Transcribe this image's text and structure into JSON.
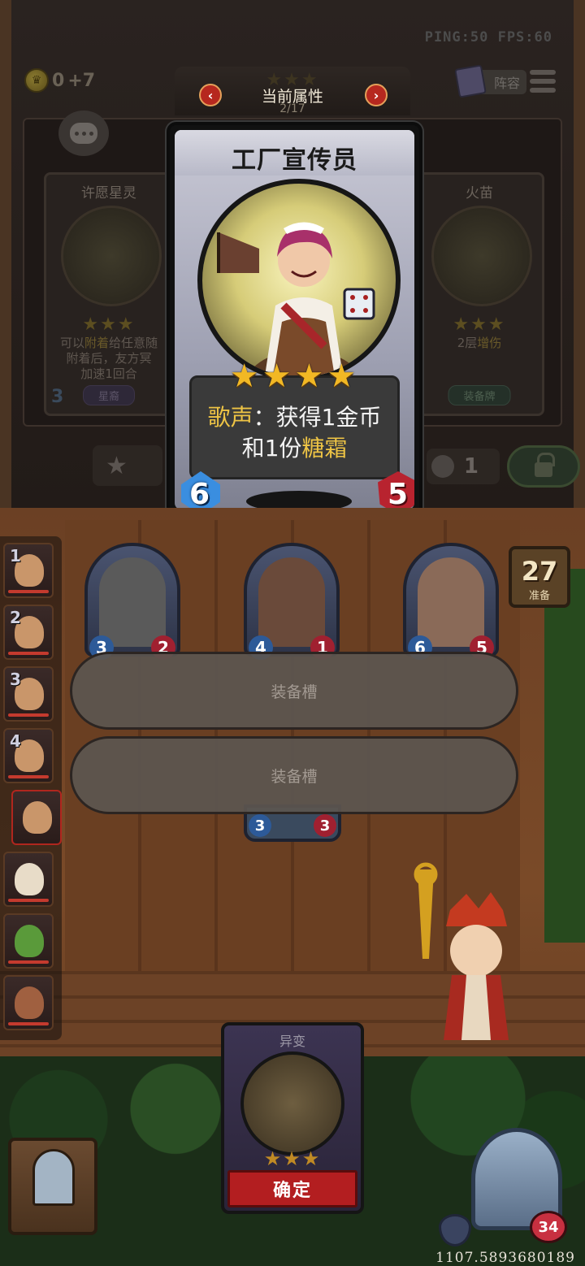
{
  "status": {
    "text": "PING:50   FPS:60"
  },
  "gold": {
    "amount": "0",
    "income": "+7"
  },
  "lineup": {
    "label": "阵容"
  },
  "attribute_panel": {
    "title": "当前属性",
    "page": "2/17",
    "prev_symbol": "‹",
    "next_symbol": "›"
  },
  "focused_card": {
    "name": "工厂宣传员",
    "stars": "★★★★",
    "star_count": 4,
    "desc_keyword": "歌声",
    "desc_sep": "：",
    "desc_line1_rest": "获得1金币",
    "desc_line2_prefix": "和1份",
    "desc_line2_keyword": "糖霜",
    "attack": "6",
    "health": "5"
  },
  "left_card": {
    "name": "许愿星灵",
    "stars": "★★★",
    "desc_prefix": "可以",
    "desc_keyword": "附着",
    "desc_rest1": "给任意随",
    "desc_line2": "附着后，友方冥",
    "desc_line3": "加速1回合",
    "cost": "3",
    "tag": "星裔"
  },
  "right_card": {
    "name": "火苗",
    "stars": "★★★",
    "desc_prefix": "2层",
    "desc_keyword": "增伤",
    "tag": "装备牌"
  },
  "right_pill": {
    "value": "1"
  },
  "roster": [
    {
      "num": "1"
    },
    {
      "num": "2"
    },
    {
      "num": "3"
    },
    {
      "num": "4"
    },
    {
      "num": ""
    },
    {
      "num": ""
    },
    {
      "num": ""
    },
    {
      "num": ""
    }
  ],
  "board": [
    {
      "atk": "3",
      "hp": "2"
    },
    {
      "atk": "4",
      "hp": "1"
    },
    {
      "atk": "6",
      "hp": "5"
    }
  ],
  "bottom_piece": {
    "atk": "3",
    "hp": "3"
  },
  "prep": {
    "count": "27",
    "label": "准备"
  },
  "equip_slots": [
    {
      "label": "装备槽"
    },
    {
      "label": "装备槽"
    }
  ],
  "mutation_card": {
    "title": "异变",
    "stars": "★★★"
  },
  "confirm": {
    "label": "确定"
  },
  "hero": {
    "hp": "34"
  },
  "session_id": "1107.5893680189",
  "colors": {
    "accent_gold": "#eec445",
    "confirm_red": "#b31e20",
    "star_gold": "#f2b824"
  },
  "icons": [
    "coin-icon",
    "book-icon",
    "menu-icon",
    "chat-icon",
    "star-up-icon",
    "lock-icon",
    "shield-icon",
    "heart-icon"
  ]
}
